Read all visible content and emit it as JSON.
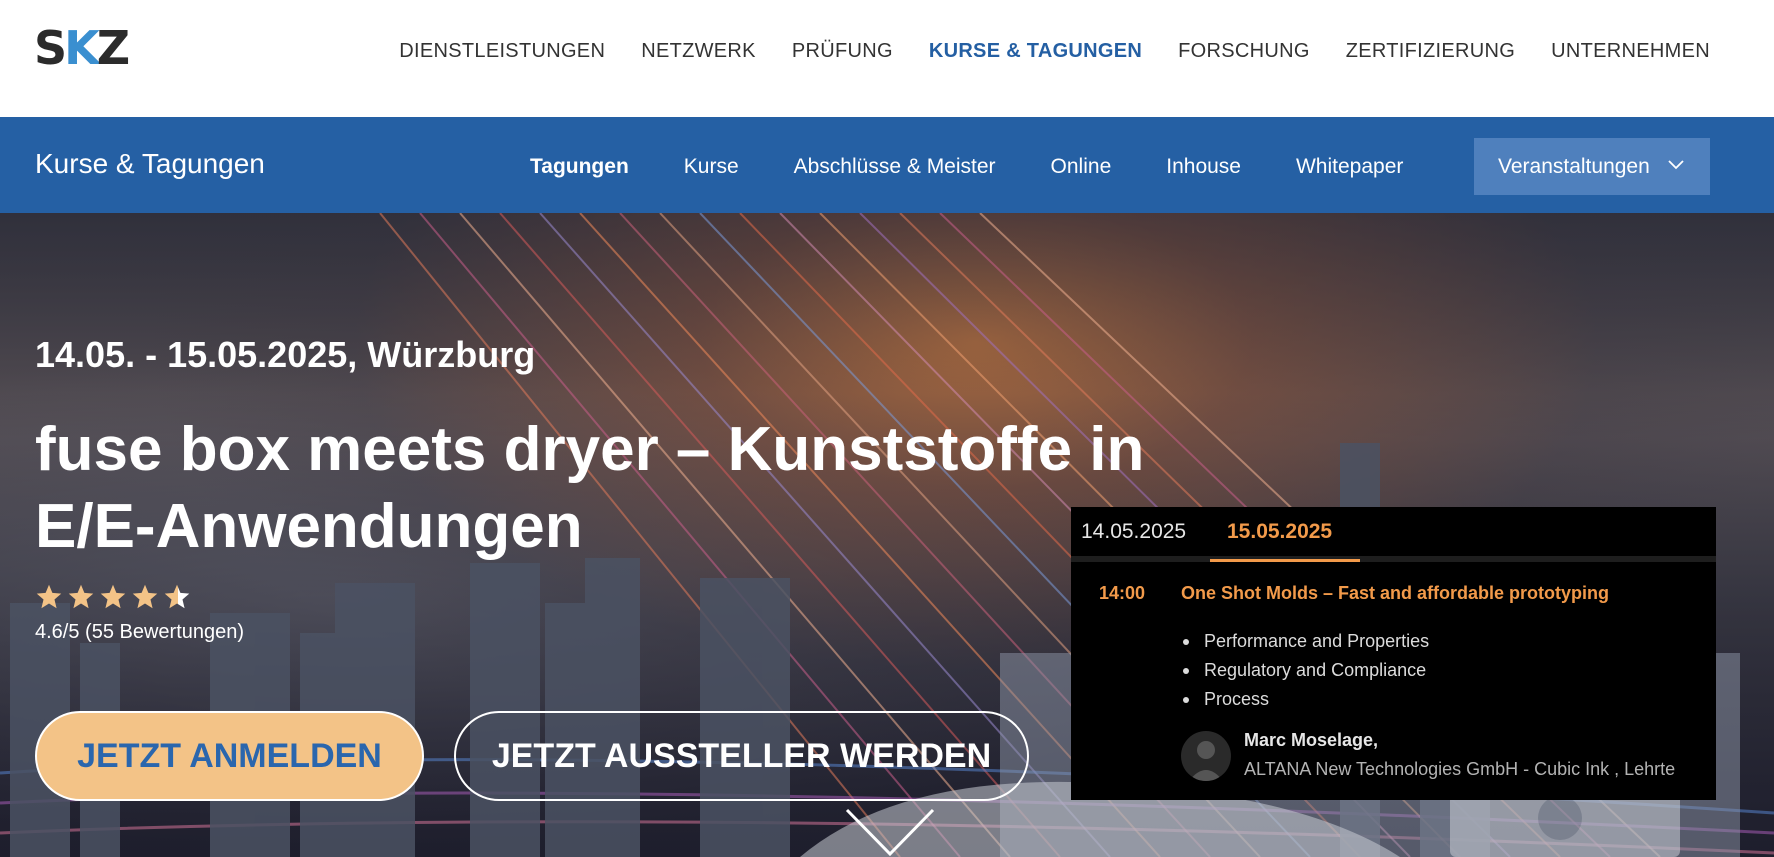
{
  "logo": {
    "text_s": "S",
    "text_k": "K",
    "text_z": "Z"
  },
  "main_nav": [
    {
      "label": "DIENSTLEISTUNGEN"
    },
    {
      "label": "NETZWERK"
    },
    {
      "label": "PRÜFUNG"
    },
    {
      "label": "KURSE & TAGUNGEN",
      "active": true
    },
    {
      "label": "FORSCHUNG"
    },
    {
      "label": "ZERTIFIZIERUNG"
    },
    {
      "label": "UNTERNEHMEN"
    }
  ],
  "sub_nav": {
    "section_title": "Kurse & Tagungen",
    "items": [
      {
        "label": "Tagungen",
        "active": true
      },
      {
        "label": "Kurse"
      },
      {
        "label": "Abschlüsse & Meister"
      },
      {
        "label": "Online"
      },
      {
        "label": "Inhouse"
      },
      {
        "label": "Whitepaper"
      }
    ],
    "dropdown_label": "Veranstaltungen"
  },
  "hero": {
    "date_location": "14.05. - 15.05.2025, Würzburg",
    "title": "fuse box meets dryer – Kunststoffe in E/E-Anwendungen",
    "rating_value": 4.6,
    "rating_max": 5,
    "rating_text": "4.6/5 (55 Bewertungen)",
    "primary_button": "JETZT ANMELDEN",
    "secondary_button": "JETZT AUSSTELLER WERDEN"
  },
  "agenda": {
    "tabs": [
      {
        "label": "14.05.2025"
      },
      {
        "label": "15.05.2025",
        "active": true
      }
    ],
    "slot": {
      "time": "14:00",
      "title": "One Shot Molds – Fast and affordable prototyping",
      "bullets": [
        "Performance and Properties",
        "Regulatory and Compliance",
        "Process"
      ],
      "speaker_name": "Marc Moselage,",
      "speaker_org": "ALTANA New Technologies GmbH - Cubic Ink , Lehrte"
    }
  },
  "colors": {
    "brand_blue": "#2560a4",
    "nav_active": "#245fa3",
    "cta_orange": "#f3c387",
    "agenda_accent": "#f29a4a",
    "logo_blue": "#3a8fd0"
  }
}
